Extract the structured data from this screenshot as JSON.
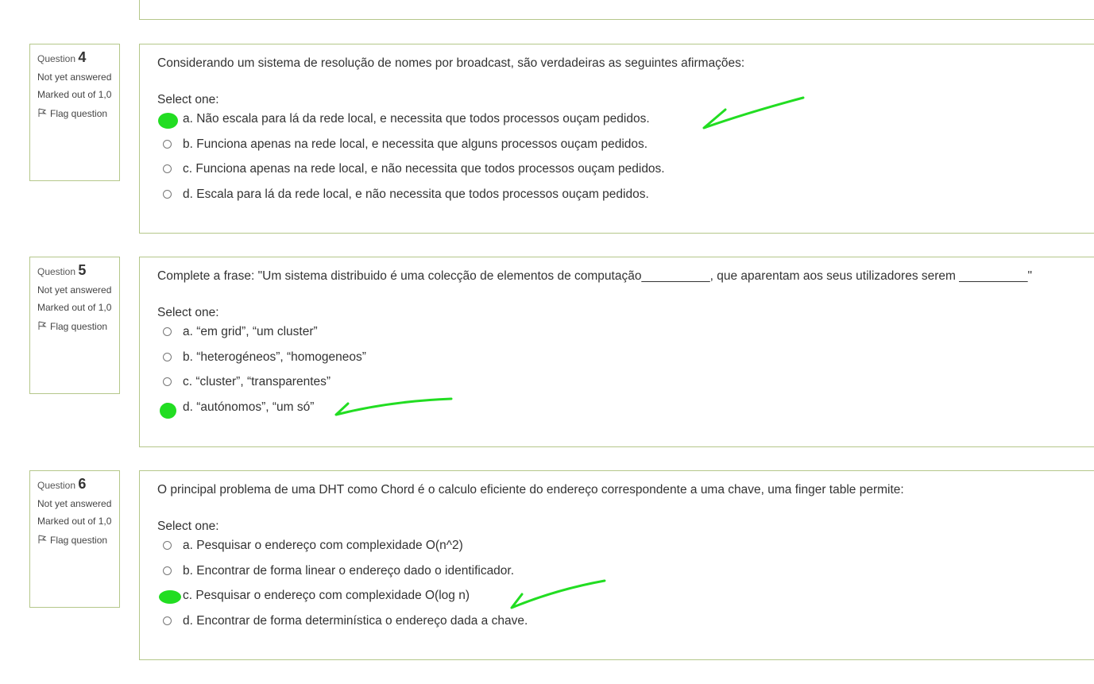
{
  "labels": {
    "question": "Question",
    "state": "Not yet answered",
    "marked": "Marked out of 1,0",
    "flag": "Flag question",
    "select_one": "Select one:"
  },
  "questions": [
    {
      "number": "4",
      "text": "Considerando um sistema de resolução de nomes por broadcast, são verdadeiras as seguintes afirmações:",
      "answers": [
        "a. Não escala para lá da rede local, e necessita que todos processos ouçam pedidos.",
        "b. Funciona apenas na rede local, e necessita que alguns processos ouçam pedidos.",
        "c. Funciona apenas na rede local, e não necessita que todos processos ouçam pedidos.",
        "d. Escala para lá da rede local, e não necessita que todos processos ouçam pedidos."
      ]
    },
    {
      "number": "5",
      "text": "Complete a frase: \"Um sistema distribuido é uma colecção de elementos de computação__________, que aparentam aos seus utilizadores serem __________\"",
      "answers": [
        "a. “em grid”, “um cluster”",
        "b. “heterogéneos”, “homogeneos”",
        "c. “cluster”, “transparentes”",
        "d. “autónomos”, “um só”"
      ]
    },
    {
      "number": "6",
      "text": "O principal problema de uma DHT como Chord é o calculo eficiente do endereço correspondente a uma chave, uma finger table permite:",
      "answers": [
        "a. Pesquisar o endereço com complexidade O(n^2)",
        "b. Encontrar de forma linear o endereço dado o identificador.",
        "c. Pesquisar o endereço com complexidade O(log n)",
        "d. Encontrar de forma determinística o endereço dada a chave."
      ]
    }
  ],
  "colors": {
    "border": "#b5c78a",
    "annotation": "#22dd22"
  }
}
